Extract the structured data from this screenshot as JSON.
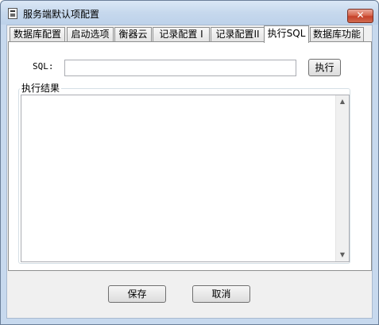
{
  "window": {
    "title": "服务端默认项配置",
    "close_glyph": "✕"
  },
  "tabs": [
    {
      "label": "数据库配置",
      "active": false
    },
    {
      "label": "启动选项",
      "active": false
    },
    {
      "label": "衡器云",
      "active": false
    },
    {
      "label": "记录配置 I",
      "active": false
    },
    {
      "label": "记录配置II",
      "active": false
    },
    {
      "label": "执行SQL",
      "active": true
    },
    {
      "label": "数据库功能",
      "active": false
    }
  ],
  "sql": {
    "label": "SQL:",
    "value": "",
    "execute_label": "执行"
  },
  "result": {
    "group_label": "执行结果",
    "value": "",
    "scroll_up": "▲",
    "scroll_down": "▼"
  },
  "footer": {
    "save_label": "保存",
    "cancel_label": "取消"
  }
}
